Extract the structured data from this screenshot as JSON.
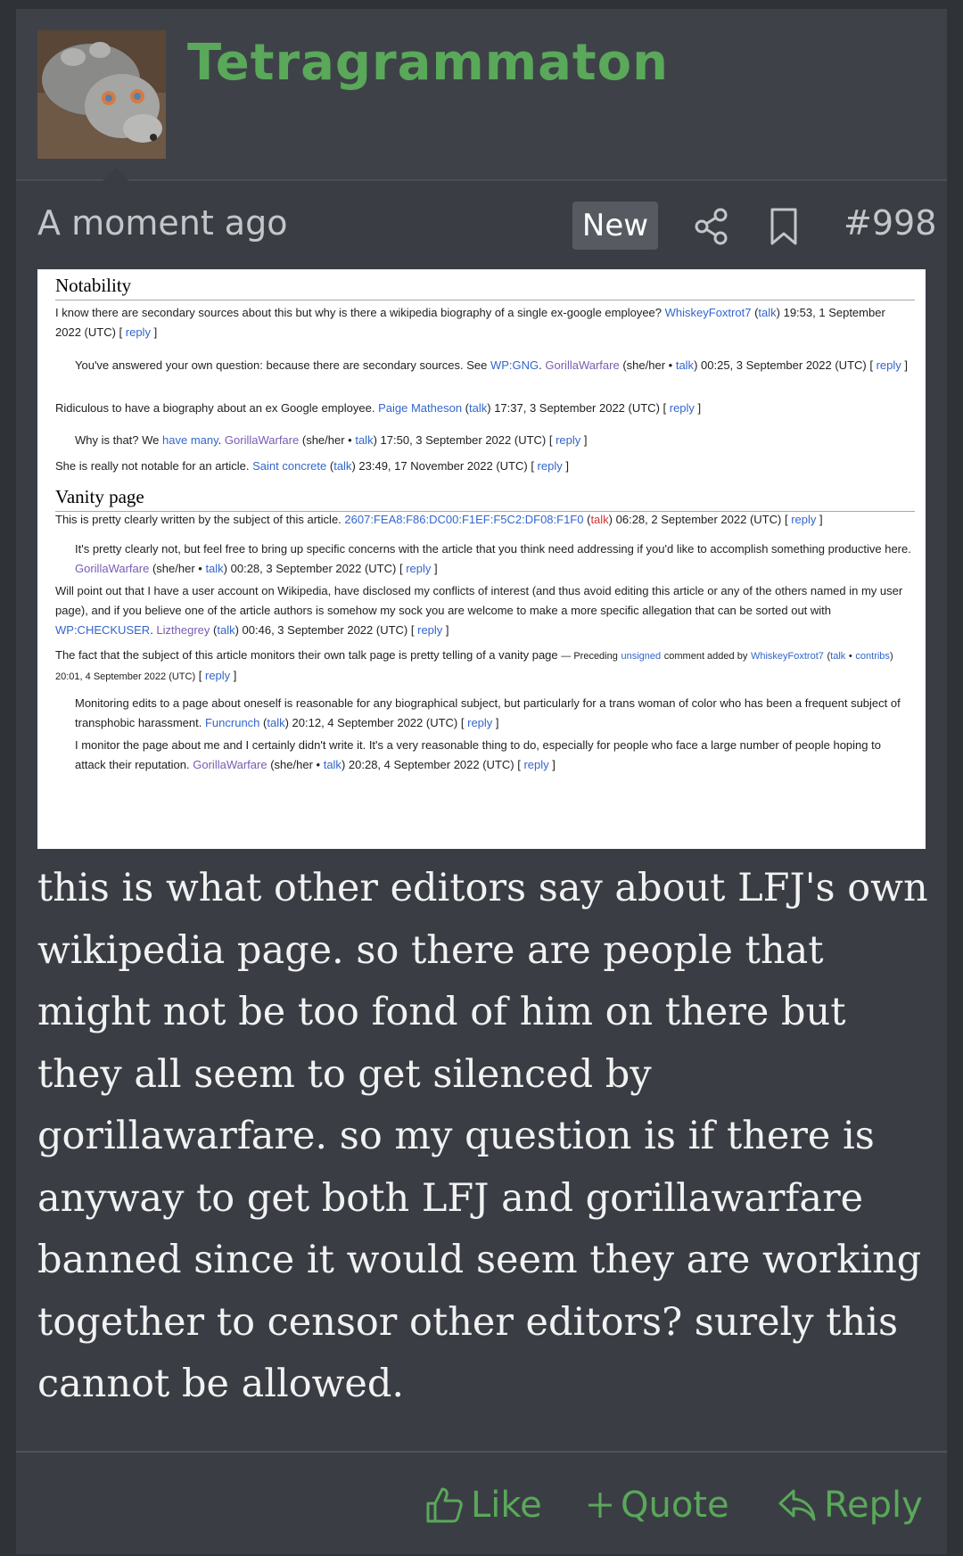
{
  "post": {
    "username": "Tetragrammaton",
    "timestamp": "A moment ago",
    "badge": "New",
    "number": "#998",
    "body": "this is what other editors say about LFJ's own wikipedia page. so there are people that might not be too fond of him on there but they all seem to get silenced by gorillawarfare. so my question is if there is anyway to get both LFJ and gorillawarfare banned since it would seem they are working together to censor other editors? surely this cannot be allowed."
  },
  "screenshot": {
    "section1_title": "Notability",
    "section2_title": "Vanity page",
    "c1_text": "I know there are secondary sources about this but why is there a wikipedia biography of a single ex-google employee?",
    "c1_user": "WhiskeyFoxtrot7",
    "c1_talk": "talk",
    "c1_time": "19:53, 1 September 2022 (UTC)",
    "c2_text": "You've answered your own question: because there are secondary sources. See",
    "c2_link": "WP:GNG",
    "c2_user": "GorillaWarfare",
    "c2_pron": "(she/her •",
    "c2_talk": "talk",
    "c2_time": "00:25, 3 September 2022 (UTC)",
    "c3_text": "Ridiculous to have a biography about an ex Google employee.",
    "c3_user": "Paige Matheson",
    "c3_talk": "talk",
    "c3_time": "17:37, 3 September 2022 (UTC)",
    "c4_text": "Why is that? We",
    "c4_link": "have many",
    "c4_user": "GorillaWarfare",
    "c4_pron": "(she/her •",
    "c4_talk": "talk",
    "c4_time": "17:50, 3 September 2022 (UTC)",
    "c5_text": "She is really not notable for an article.",
    "c5_user": "Saint concrete",
    "c5_talk": "talk",
    "c5_time": "23:49, 17 November 2022 (UTC)",
    "v1_text": "This is pretty clearly written by the subject of this article.",
    "v1_user": "2607:FEA8:F86:DC00:F1EF:F5C2:DF08:F1F0",
    "v1_talk": "talk",
    "v1_time": "06:28, 2 September 2022 (UTC)",
    "v2_text": "It's pretty clearly not, but feel free to bring up specific concerns with the article that you think need addressing if you'd like to accomplish something productive here.",
    "v2_user": "GorillaWarfare",
    "v2_pron": "(she/her •",
    "v2_talk": "talk",
    "v2_time": "00:28, 3 September 2022 (UTC)",
    "v3_text": "Will point out that I have a user account on Wikipedia, have disclosed my conflicts of interest (and thus avoid editing this article or any of the others named in my user page), and if you believe one of the article authors is somehow my sock you are welcome to make a more specific allegation that can be sorted out with",
    "v3_link": "WP:CHECKUSER",
    "v3_user": "Lizthegrey",
    "v3_talk": "talk",
    "v3_time": "00:46, 3 September 2022 (UTC)",
    "v4_text": "The fact that the subject of this article monitors their own talk page is pretty telling of a vanity page",
    "v4_pre": "— Preceding",
    "v4_unsigned": "unsigned",
    "v4_added": "comment added by",
    "v4_user": "WhiskeyFoxtrot7",
    "v4_talk": "talk",
    "v4_contribs": "contribs",
    "v4_time": "20:01, 4 September 2022 (UTC)",
    "v5_text": "Monitoring edits to a page about oneself is reasonable for any biographical subject, but particularly for a trans woman of color who has been a frequent subject of transphobic harassment.",
    "v5_user": "Funcrunch",
    "v5_talk": "talk",
    "v5_time": "20:12, 4 September 2022 (UTC)",
    "v6_text": "I monitor the page about me and I certainly didn't write it. It's a very reasonable thing to do, especially for people who face a large number of people hoping to attack their reputation.",
    "v6_user": "GorillaWarfare",
    "v6_pron": "(she/her •",
    "v6_talk": "talk",
    "v6_time": "20:28, 4 September 2022 (UTC)",
    "reply": "reply"
  },
  "actions": {
    "like": "Like",
    "quote": "Quote",
    "reply": "Reply"
  },
  "colors": {
    "accent_green": "#5aa85a",
    "background": "#2f3237",
    "post_bg": "#3a3e44"
  },
  "icons": [
    "share-icon",
    "bookmark-icon",
    "thumbs-up-icon",
    "plus-icon",
    "reply-icon"
  ]
}
